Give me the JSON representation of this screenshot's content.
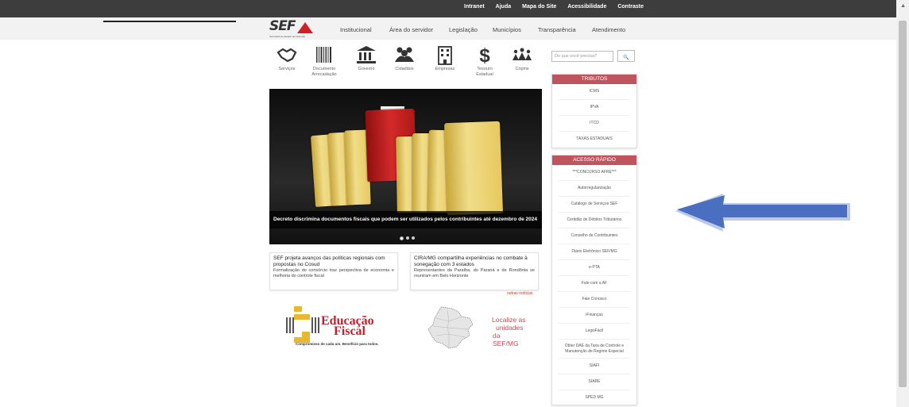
{
  "toplinks": [
    "Intranet",
    "Ajuda",
    "Mapa do Site",
    "Acessibilidade",
    "Contraste"
  ],
  "logo": {
    "text": "SEF",
    "sub": "Secretaria de Estado de Fazenda"
  },
  "nav": [
    "Institucional",
    "Área do servidor",
    "Legislação",
    "Municípios",
    "Transparência",
    "Atendimento"
  ],
  "icons": [
    {
      "icon": "handshake-icon",
      "label": "Serviços",
      "label2": ""
    },
    {
      "icon": "barcode-icon",
      "label": "Documento",
      "label2": "Arrecadação"
    },
    {
      "icon": "government-icon",
      "label": "Governo",
      "label2": ""
    },
    {
      "icon": "people-icon",
      "label": "Cidadãos",
      "label2": ""
    },
    {
      "icon": "building-icon",
      "label": "Empresas",
      "label2": ""
    },
    {
      "icon": "dollar-icon",
      "label": "Tesouro",
      "label2": "Estadual"
    },
    {
      "icon": "group-icon",
      "label": "Copins",
      "label2": ""
    }
  ],
  "hero": {
    "caption": "Decreto discrimina documentos fiscais que podem ser utilizados pelos contribuintes até dezembro de 2024"
  },
  "news": [
    {
      "title": "SEF projeta avanços das políticas regionais com propostas no Cosud",
      "desc": "Formalização do consórcio traz perspectiva de economia e melhoria do controle fiscal"
    },
    {
      "title": "CIRA/MG compartilha experiências no combate à sonegação com 3 estados",
      "desc": "Representantes da Paraíba, do Paraná e de Rondônia se reuniram em Belo Horizonte"
    }
  ],
  "outras": "outras notícias",
  "edu": {
    "title1": "Educação",
    "title2": "Fiscal",
    "tagline": "Compromisso de cada um. Benefício para todos."
  },
  "localize": {
    "l1": "Localize as",
    "l2": "unidades",
    "l3": "da SEF/MG"
  },
  "search": {
    "placeholder": "Do que você precisa?",
    "btn": "🔍"
  },
  "tributos": {
    "title": "TRIBUTOS",
    "items": [
      "ICMS",
      "IPVA",
      "ITCD",
      "TAXAS ESTADUAIS"
    ]
  },
  "acesso": {
    "title": "ACESSO RÁPIDO",
    "items": [
      "***CONCURSO AFRE***",
      "Autorregularização",
      "Catálogo de Serviços SEF",
      "Certidão de Débitos Tributários",
      "Conselho de Contribuintes",
      "Diário Eletrônico SEF/MG",
      "e-PTA",
      "Fale com a AF",
      "Fale Conosco",
      "iFinanças",
      "LegisFácil",
      "Obter DAE da Taxa de Controle e Manutenção de Regime Especial",
      "SIAFI",
      "SIARE",
      "SPED MG"
    ]
  },
  "colors": {
    "panel_header": "#c0545e",
    "arrow": "#4a6fc0",
    "edu_red": "#c0202a",
    "localize_red": "#d9464f"
  }
}
